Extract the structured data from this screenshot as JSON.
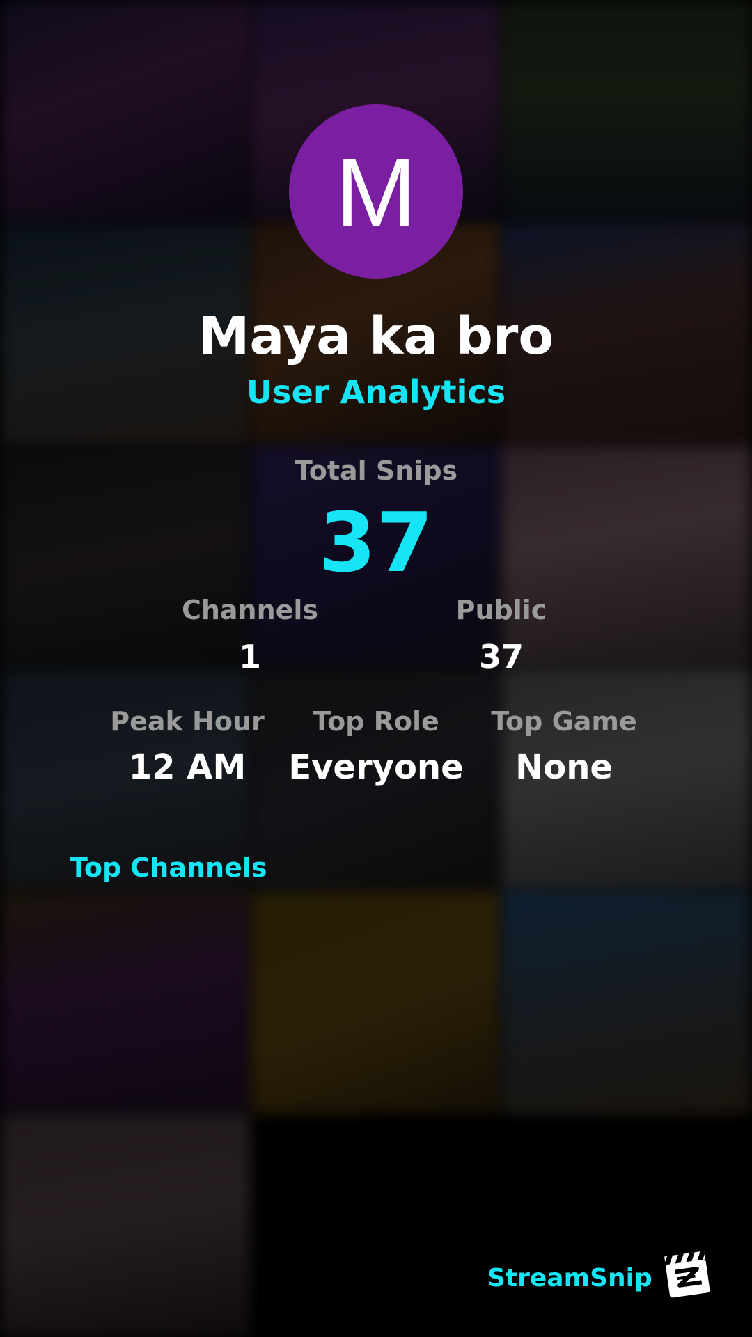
{
  "profile": {
    "avatar_letter": "M",
    "username": "Maya ka bro",
    "subtitle": "User Analytics"
  },
  "stats": {
    "total_snips_label": "Total Snips",
    "total_snips_value": "37",
    "channels_label": "Channels",
    "channels_value": "1",
    "public_label": "Public",
    "public_value": "37",
    "peak_hour_label": "Peak Hour",
    "peak_hour_value": "12 AM",
    "top_role_label": "Top Role",
    "top_role_value": "Everyone",
    "top_game_label": "Top Game",
    "top_game_value": "None"
  },
  "sections": {
    "top_channels_title": "Top Channels"
  },
  "brand": {
    "name": "StreamSnip",
    "icon": "clapperboard-icon"
  },
  "colors": {
    "accent": "#17e5f5",
    "avatar": "#7b1fa2",
    "label": "#9a9a9a",
    "value": "#ffffff"
  }
}
